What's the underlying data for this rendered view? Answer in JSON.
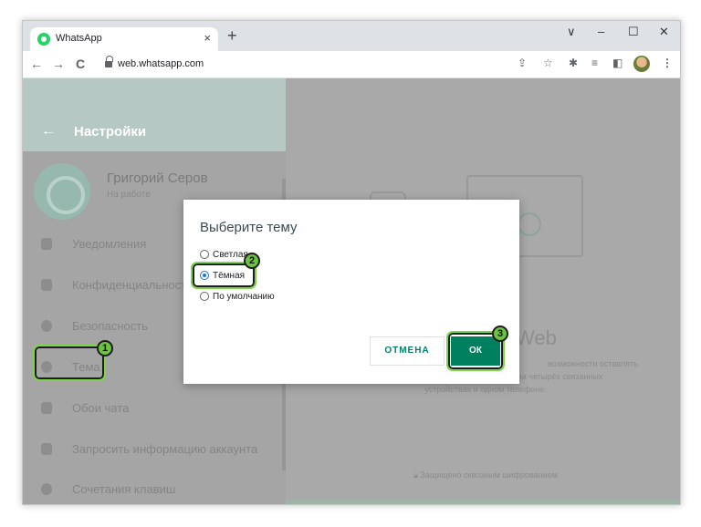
{
  "browser": {
    "tab_title": "WhatsApp",
    "tab_close": "×",
    "new_tab": "+",
    "window_controls": [
      "∨",
      "–",
      "☐",
      "✕"
    ],
    "nav": {
      "back": "←",
      "forward": "→",
      "reload": "C"
    },
    "url": "web.whatsapp.com",
    "toolbar_icons": [
      "share-icon",
      "star-icon",
      "extensions-icon",
      "reading-list-icon",
      "side-panel-icon",
      "profile-avatar",
      "menu-icon"
    ]
  },
  "settings": {
    "back_arrow": "←",
    "title": "Настройки",
    "profile_name": "Григорий Серов",
    "profile_status": "На работе",
    "menu": [
      {
        "label": "Уведомления",
        "icon": "bell-icon"
      },
      {
        "label": "Конфиденциальность",
        "icon": "lock-icon"
      },
      {
        "label": "Безопасность",
        "icon": "shield-icon"
      },
      {
        "label": "Тема",
        "icon": "theme-icon"
      },
      {
        "label": "Обои чата",
        "icon": "wallpaper-icon"
      },
      {
        "label": "Запросить информацию аккаунта",
        "icon": "document-icon"
      },
      {
        "label": "Сочетания клавиш",
        "icon": "keyboard-icon"
      }
    ]
  },
  "welcome": {
    "title": "Web",
    "line1": "возможности оставлять",
    "line2": "Используйте WhatsApp одновременно на четырёх связанных",
    "line3": "устройствах и одном телефоне.",
    "encryption_note": "Защищено сквозным шифрованием"
  },
  "dialog": {
    "title": "Выберите тему",
    "options": [
      {
        "label": "Светлая",
        "checked": false
      },
      {
        "label": "Тёмная",
        "checked": true
      },
      {
        "label": "По умолчанию",
        "checked": false
      }
    ],
    "cancel_label": "ОТМЕНА",
    "ok_label": "ОК"
  },
  "callouts": [
    "1",
    "2",
    "3"
  ],
  "colors": {
    "accent": "#00805e",
    "radio_selected": "#1a73e8",
    "highlight": "#7dd64a"
  }
}
